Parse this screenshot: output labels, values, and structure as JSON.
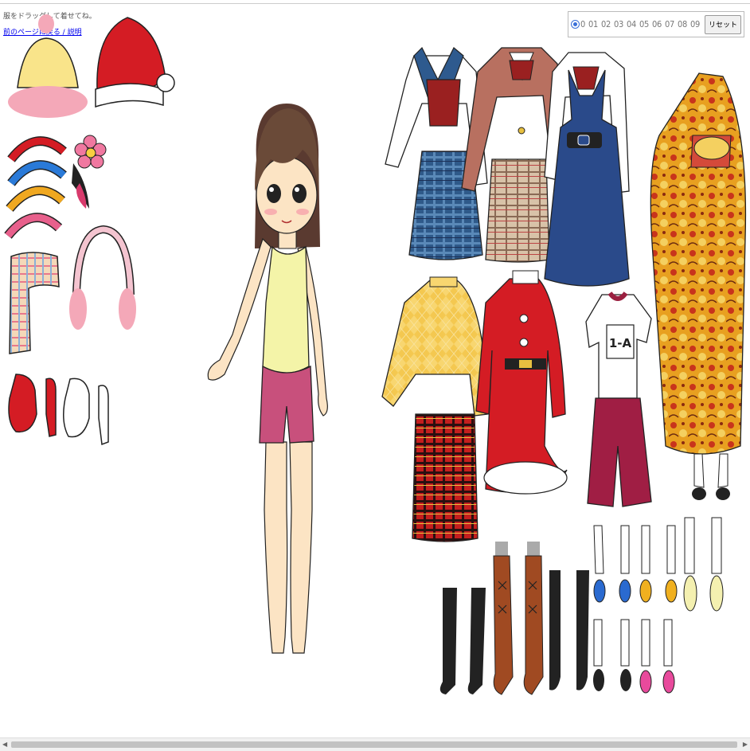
{
  "header": {
    "instruction": "服をドラッグして着せてね。",
    "back_link": "前のページに戻る / 説明"
  },
  "picker": {
    "options": [
      "0",
      "01",
      "02",
      "03",
      "04",
      "05",
      "06",
      "07",
      "08",
      "09"
    ],
    "selected": "0",
    "reset_label": "リセット"
  },
  "gym_shirt_label": "1-A"
}
